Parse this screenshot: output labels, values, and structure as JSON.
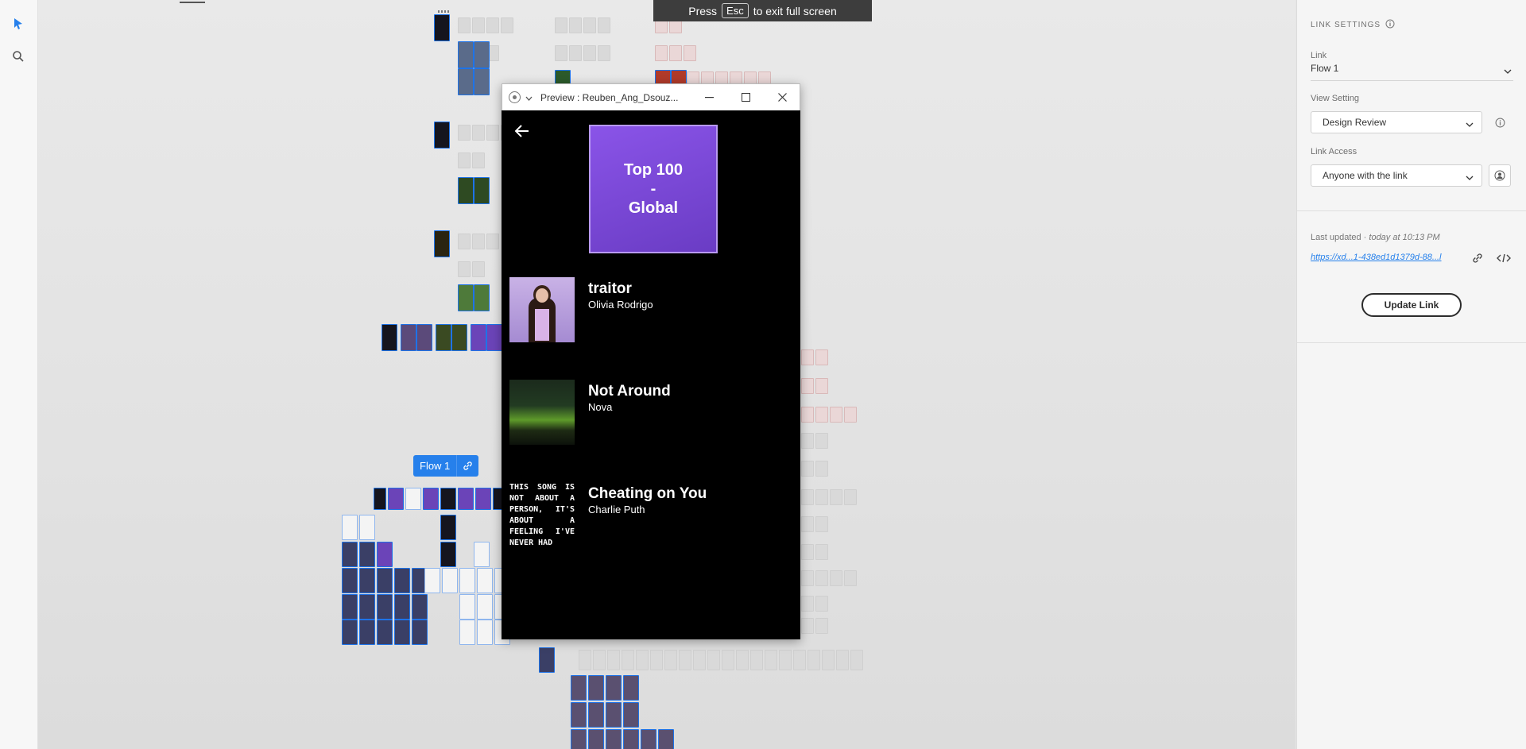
{
  "fullscreen_banner": {
    "press": "Press",
    "key": "Esc",
    "rest": "to exit full screen"
  },
  "flow_tag": {
    "label": "Flow 1"
  },
  "preview_window": {
    "title": "Preview : Reuben_Ang_Dsouz...",
    "album_title": "Top 100\n-\nGlobal",
    "songs": [
      {
        "title": "traitor",
        "artist": "Olivia Rodrigo"
      },
      {
        "title": "Not Around",
        "artist": "Nova"
      },
      {
        "title": "Cheating on You",
        "artist": "Charlie Puth",
        "cover_text": "THIS SONG IS NOT ABOUT A PERSON, IT'S ABOUT A FEELING I'VE NEVER HAD"
      }
    ]
  },
  "link_settings": {
    "heading": "LINK SETTINGS",
    "link_label": "Link",
    "link_value": "Flow 1",
    "view_setting_label": "View Setting",
    "view_setting_value": "Design Review",
    "link_access_label": "Link Access",
    "link_access_value": "Anyone with the link",
    "last_updated_label": "Last updated · ",
    "last_updated_value": "today at 10:13 PM",
    "url": "https://xd...1-438ed1d1379d-88...l",
    "update_button": "Update Link"
  },
  "colors": {
    "accent": "#2680eb",
    "app_bg": "#000000",
    "album": "#7b48d8"
  }
}
